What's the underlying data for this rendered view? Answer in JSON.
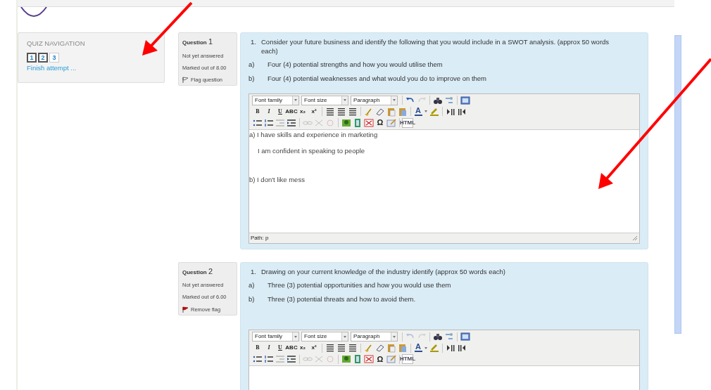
{
  "quiz_navigation": {
    "title": "QUIZ NAVIGATION",
    "buttons": [
      {
        "label": "1",
        "current": true
      },
      {
        "label": "2",
        "current": true
      },
      {
        "label": "3",
        "current": false
      }
    ],
    "finish_link": "Finish attempt ..."
  },
  "questions": [
    {
      "heading": "Question",
      "number": "1",
      "status": "Not yet answered",
      "marks": "Marked out of 8.00",
      "flagged": false,
      "flag_label": "Flag question",
      "prompt_number": "1.",
      "prompt": "Consider your future business and identify the following that you would include in a SWOT analysis. (approx 50 words each)",
      "parts": [
        {
          "label": "a)",
          "text": "Four (4) potential strengths and how you would utilise them"
        },
        {
          "label": "b)",
          "text": "Four (4) potential weaknesses and what would you do to improve on them"
        }
      ],
      "editor": {
        "selects": [
          "Font family",
          "Font size",
          "Paragraph"
        ],
        "text_buttons": [
          "B",
          "I",
          "U",
          "ABC",
          "x₂",
          "x²",
          "A",
          "Ω",
          "HTML"
        ],
        "undo_available": true,
        "lines": [
          {
            "kind": "plain",
            "text": "a) I have skills and experience in marketing"
          },
          {
            "kind": "indented",
            "text": "I am confident in speaking to people"
          },
          {
            "kind": "spaced",
            "text": "b) I don't like mess"
          }
        ],
        "path": "Path: p"
      }
    },
    {
      "heading": "Question",
      "number": "2",
      "status": "Not yet answered",
      "marks": "Marked out of 6.00",
      "flagged": true,
      "flag_label": "Remove flag",
      "prompt_number": "1.",
      "prompt": "Drawing on your current knowledge of the industry identify (approx 50 words each)",
      "parts": [
        {
          "label": "a)",
          "text": "Three (3) potential opportunities and how you would use them"
        },
        {
          "label": "b)",
          "text": "Three (3) potential threats and how to avoid them."
        }
      ],
      "editor": {
        "selects": [
          "Font family",
          "Font size",
          "Paragraph"
        ],
        "text_buttons": [
          "B",
          "I",
          "U",
          "ABC",
          "x₂",
          "x²",
          "A",
          "Ω",
          "HTML"
        ],
        "undo_available": false
      }
    }
  ]
}
